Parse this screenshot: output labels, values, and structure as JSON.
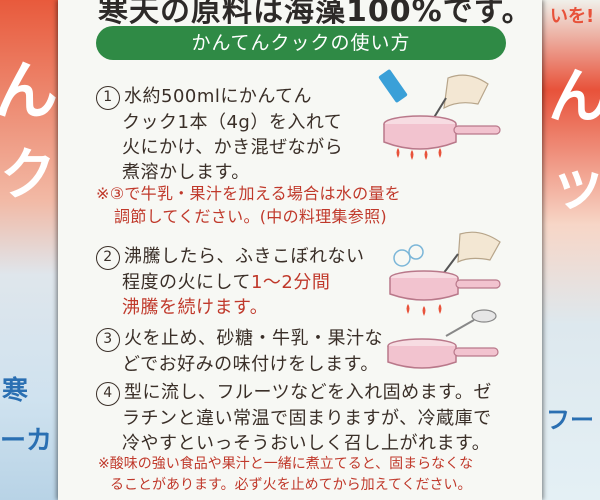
{
  "header": {
    "top_text": "寒天の原料は海藻100%です。",
    "banner": "かんてんクックの使い方"
  },
  "steps": [
    {
      "num": "1",
      "lines": [
        "水約500mlにかんてん",
        "クック1本（4g）を入れて",
        "火にかけ、かき混ぜながら",
        "煮溶かします。"
      ]
    },
    {
      "num": "2",
      "lines": [
        "沸騰したら、ふきこぼれない",
        "程度の火にして",
        "1〜2分間",
        "沸騰を続けます。"
      ]
    },
    {
      "num": "3",
      "lines": [
        "火を止め、砂糖・牛乳・果汁な",
        "どでお好みの味付けをします。"
      ]
    },
    {
      "num": "4",
      "lines": [
        "型に流し、フルーツなどを入れ固めます。ゼ",
        "ラチンと違い常温で固まりますが、冷蔵庫で",
        "冷やすといっそうおいしく召し上がれます。"
      ]
    }
  ],
  "note1": [
    "※③で牛乳・果汁を加える場合は水の量を",
    "調節してください。(中の料理集参照)"
  ],
  "footnote": [
    "※酸味の強い食品や果汁と一緒に煮立てると、固まらなくな",
    "ることがあります。必ず火を止めてから加えてください。"
  ],
  "side_text": {
    "left": [
      "ん",
      "ク",
      "寒",
      "ーカ"
    ],
    "right": [
      "いを!",
      "ん",
      "ッ",
      "フー"
    ]
  },
  "colors": {
    "banner_green": "#2f8a45",
    "note_red": "#c0392b",
    "text_dark": "#3a2f28",
    "card_bg": "#f7f8f4"
  }
}
